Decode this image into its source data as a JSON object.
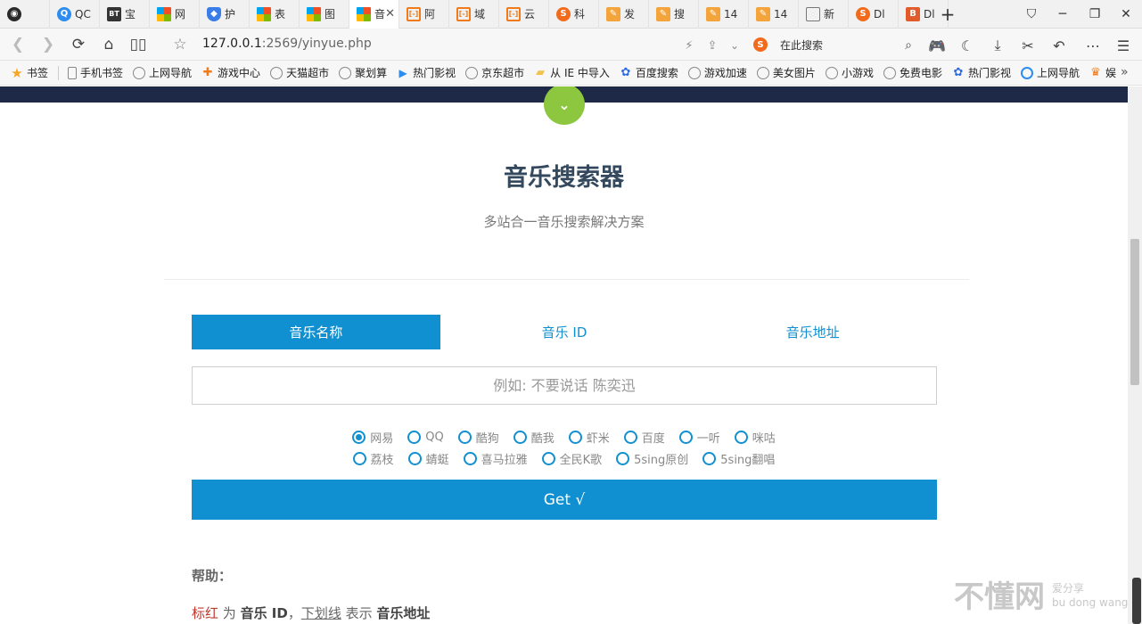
{
  "browser": {
    "tabs": [
      {
        "icon": "qq-penguin-icon",
        "label": ""
      },
      {
        "icon": "search-circle-icon",
        "label": "QC"
      },
      {
        "icon": "bt-icon",
        "label": "宝"
      },
      {
        "icon": "windows-icon",
        "label": "网"
      },
      {
        "icon": "shield-icon",
        "label": "护"
      },
      {
        "icon": "windows-icon",
        "label": "表"
      },
      {
        "icon": "windows-icon",
        "label": "图"
      },
      {
        "icon": "windows-icon",
        "label": "音",
        "active": true
      },
      {
        "icon": "bracket-icon",
        "label": "阿"
      },
      {
        "icon": "bracket-icon",
        "label": "域"
      },
      {
        "icon": "bracket-icon",
        "label": "云"
      },
      {
        "icon": "sogou-icon",
        "label": "科"
      },
      {
        "icon": "pen-icon",
        "label": "发"
      },
      {
        "icon": "pen-icon",
        "label": "搜"
      },
      {
        "icon": "pen-icon",
        "label": "14"
      },
      {
        "icon": "pen-icon",
        "label": "14"
      },
      {
        "icon": "grid-icon",
        "label": "新"
      },
      {
        "icon": "sogou-icon",
        "label": "Dl"
      },
      {
        "icon": "b-icon",
        "label": "Dl"
      }
    ],
    "address": {
      "host": "127.0.0.1",
      "rest": ":2569/yinyue.php"
    },
    "search_placeholder": "在此搜索",
    "bookmarks": [
      {
        "icon": "star-icon",
        "label": "书签"
      },
      {
        "icon": "phone-icon",
        "label": "手机书签"
      },
      {
        "icon": "globe-icon",
        "label": "上网导航"
      },
      {
        "icon": "gamepad-icon",
        "label": "游戏中心"
      },
      {
        "icon": "globe-icon",
        "label": "天猫超市"
      },
      {
        "icon": "globe-icon",
        "label": "聚划算"
      },
      {
        "icon": "play-icon",
        "label": "热门影视"
      },
      {
        "icon": "globe-icon",
        "label": "京东超市"
      },
      {
        "icon": "folder-icon",
        "label": "从 IE 中导入"
      },
      {
        "icon": "paw-icon",
        "label": "百度搜索"
      },
      {
        "icon": "globe-icon",
        "label": "游戏加速"
      },
      {
        "icon": "globe-icon",
        "label": "美女图片"
      },
      {
        "icon": "globe-icon",
        "label": "小游戏"
      },
      {
        "icon": "globe-icon",
        "label": "免费电影"
      },
      {
        "icon": "paw-icon",
        "label": "热门影视"
      },
      {
        "icon": "search-circle-icon",
        "label": "上网导航"
      },
      {
        "icon": "crown-icon",
        "label": "娱"
      }
    ],
    "more_symbol": "»"
  },
  "page": {
    "title": "音乐搜索器",
    "subtitle": "多站合一音乐搜索解决方案",
    "search_tabs": [
      {
        "label": "音乐名称",
        "active": true
      },
      {
        "label": "音乐 ID",
        "active": false
      },
      {
        "label": "音乐地址",
        "active": false
      }
    ],
    "query": {
      "value": "",
      "placeholder": "例如: 不要说话 陈奕迅"
    },
    "sites_row1": [
      {
        "label": "网易",
        "checked": true
      },
      {
        "label": "QQ",
        "checked": false
      },
      {
        "label": "酷狗",
        "checked": false
      },
      {
        "label": "酷我",
        "checked": false
      },
      {
        "label": "虾米",
        "checked": false
      },
      {
        "label": "百度",
        "checked": false
      },
      {
        "label": "一听",
        "checked": false
      },
      {
        "label": "咪咕",
        "checked": false
      }
    ],
    "sites_row2": [
      {
        "label": "荔枝",
        "checked": false
      },
      {
        "label": "蜻蜓",
        "checked": false
      },
      {
        "label": "喜马拉雅",
        "checked": false
      },
      {
        "label": "全民K歌",
        "checked": false
      },
      {
        "label": "5sing原创",
        "checked": false
      },
      {
        "label": "5sing翻唱",
        "checked": false
      }
    ],
    "submit_label": "Get √",
    "help": {
      "title": "帮助：",
      "red_word": "标红",
      "w1": " 为 ",
      "b1": "音乐 ID",
      "w2": "，",
      "underline_word": "下划线",
      "w3": " 表示 ",
      "b2": "音乐地址"
    }
  },
  "watermark": {
    "main": "不懂网",
    "small1": "爱分享",
    "small2": "bu dong wang"
  },
  "colors": {
    "accent": "#1090d0",
    "hero": "#1d2947",
    "down_button": "#8dc63f",
    "title": "#34495e"
  }
}
